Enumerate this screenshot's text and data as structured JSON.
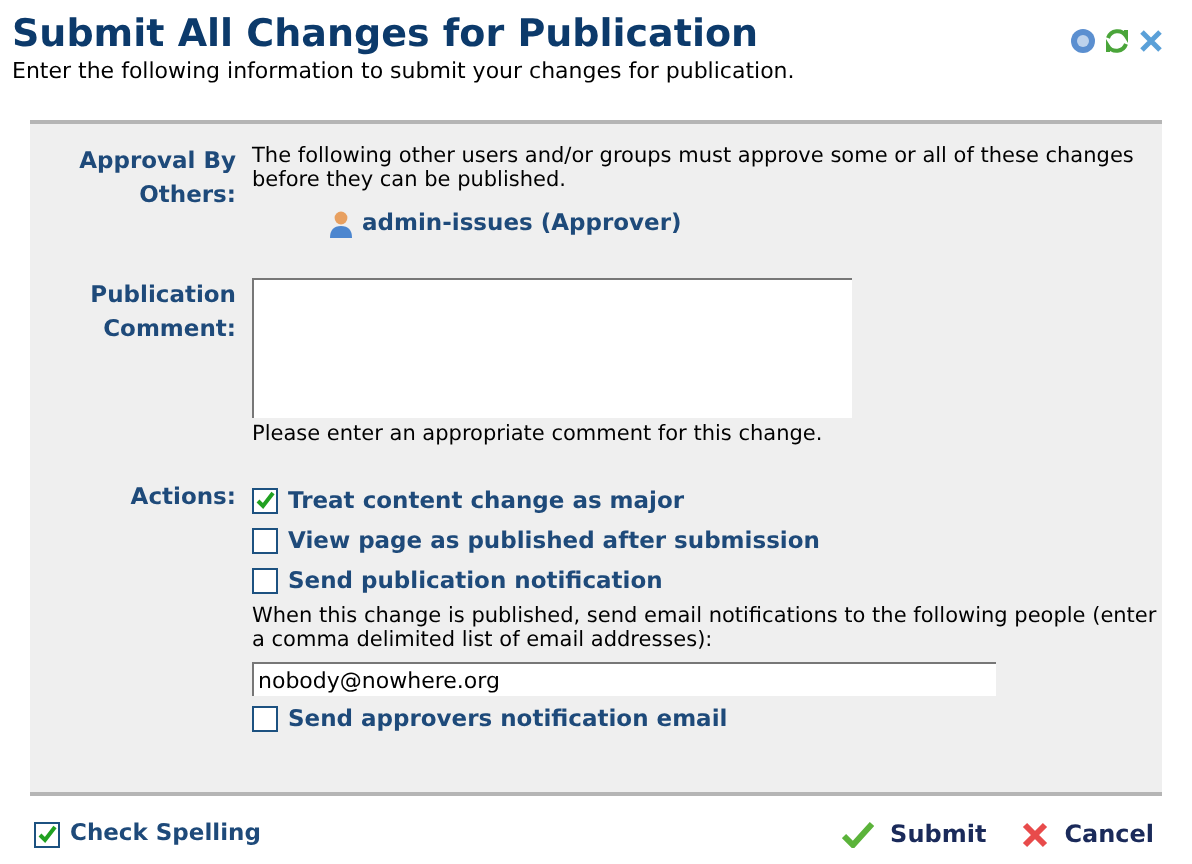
{
  "title": "Submit All Changes for Publication",
  "subtitle": "Enter the following information to submit your changes for publication.",
  "approval": {
    "label": "Approval By Others:",
    "text": "The following other users and/or groups must approve some or all of these changes before they can be published.",
    "approvers": [
      "admin-issues (Approver)"
    ]
  },
  "comment": {
    "label": "Publication Comment:",
    "hint": "Please enter an appropriate comment for this change."
  },
  "actions": {
    "label": "Actions:",
    "items": [
      {
        "kind": "checkbox",
        "label": "Treat content change as major",
        "checked": true
      },
      {
        "kind": "checkbox",
        "label": "View page as published after submission",
        "checked": false
      },
      {
        "kind": "checkbox",
        "label": "Send publication notification",
        "checked": false
      },
      {
        "kind": "note",
        "text": "When this change is published, send email notifications to the following people (enter a comma delimited list of email addresses):"
      },
      {
        "kind": "input",
        "value": "nobody@nowhere.org"
      },
      {
        "kind": "checkbox",
        "label": "Send approvers notification email",
        "checked": false
      }
    ]
  },
  "check_spelling": {
    "label": "Check Spelling",
    "checked": true
  },
  "buttons": [
    {
      "kind": "submit",
      "label": "Submit"
    },
    {
      "kind": "cancel",
      "label": "Cancel"
    }
  ]
}
